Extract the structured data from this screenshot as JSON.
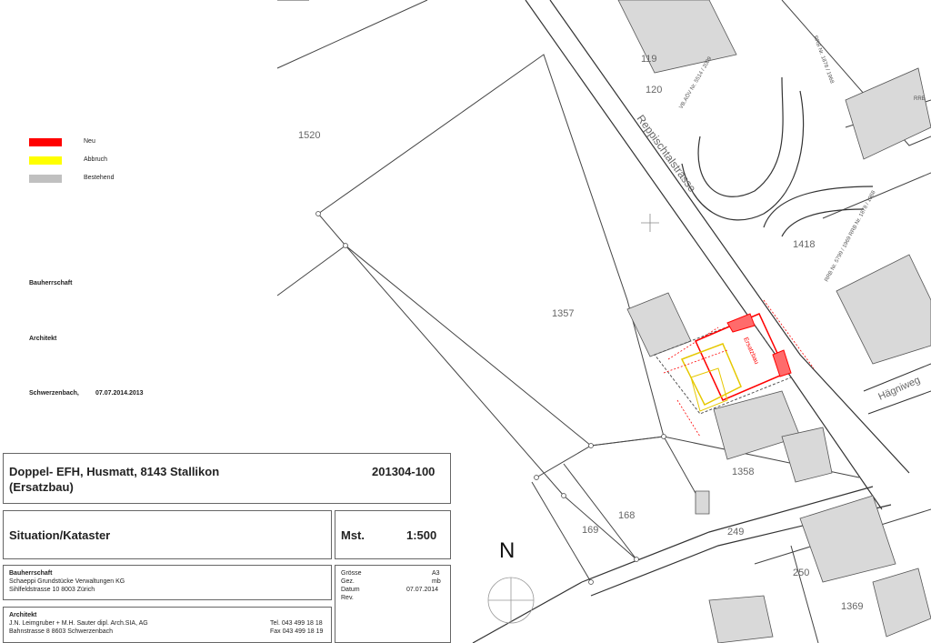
{
  "legend": [
    {
      "label": "Neu",
      "color": "#ff0000"
    },
    {
      "label": "Abbruch",
      "color": "#ffff00"
    },
    {
      "label": "Bestehend",
      "color": "#c0c0c0"
    }
  ],
  "labels": {
    "bauherrschaft": "Bauherrschaft",
    "architekt": "Architekt",
    "place": "Schwerzenbach,",
    "date": "07.07.2014.2013"
  },
  "titleblock": {
    "project_line1": "Doppel- EFH, Husmatt, 8143 Stallikon",
    "project_line2": "(Ersatzbau)",
    "project_no": "201304-100",
    "plan_title": "Situation/Kataster",
    "scale_label": "Mst.",
    "scale_value": "1:500",
    "owner_heading": "Bauherrschaft",
    "owner_name": "Schaeppi Grundstücke Verwaltungen KG",
    "owner_address": "Sihlfeldstrasse 10    8003 Zürich",
    "architect_heading": "Architekt",
    "architect_name": "J.N. Leimgruber + M.H. Sauter dipl. Arch.SIA, AG",
    "architect_address": "Bahnstrasse 8      8603 Schwerzenbach",
    "tel": "Tel. 043 499 18 18",
    "fax": "Fax 043 499 18 19",
    "meta": [
      {
        "key": "Grösse",
        "value": "A3"
      },
      {
        "key": "Gez.",
        "value": "mb"
      },
      {
        "key": "Datum",
        "value": "07.07.2014"
      },
      {
        "key": "Rev.",
        "value": ""
      }
    ]
  },
  "map": {
    "north": "N",
    "parcels": [
      "1520",
      "1357",
      "1418",
      "1358",
      "169",
      "168",
      "249",
      "250",
      "1369",
      "119",
      "120"
    ],
    "streets": [
      "Reppischtalstrasse",
      "Hägniweg"
    ],
    "building_label": "Ersatzbau",
    "rrb_notes": [
      "RRB Nr. 1878 / 1968",
      "VB.AÖV Nr. 5514 / 2009",
      "RRB Nr. 5799 / 1969 RRB Nr. 1878 / 1968",
      "RRB"
    ]
  }
}
